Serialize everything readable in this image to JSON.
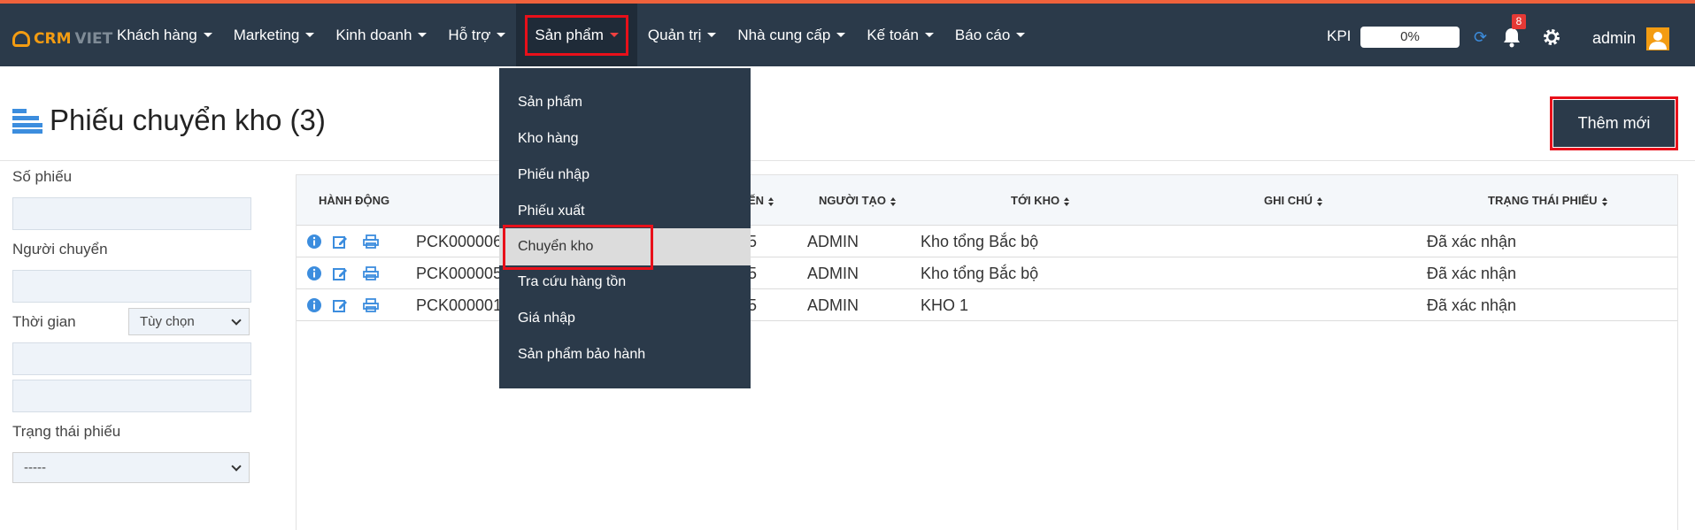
{
  "brand": {
    "logo_crm": "CRM",
    "logo_viet": "VIET"
  },
  "nav": [
    {
      "label": "Khách hàng"
    },
    {
      "label": "Marketing"
    },
    {
      "label": "Kinh doanh"
    },
    {
      "label": "Hỗ trợ"
    },
    {
      "label": "Sản phẩm",
      "active": true
    },
    {
      "label": "Quản trị"
    },
    {
      "label": "Nhà cung cấp"
    },
    {
      "label": "Kế toán"
    },
    {
      "label": "Báo cáo"
    }
  ],
  "header_right": {
    "kpi_label": "KPI",
    "kpi_value": "0%",
    "notification_count": "8",
    "user_name": "admin"
  },
  "page": {
    "title": "Phiếu chuyển kho (3)",
    "add_button_label": "Thêm mới"
  },
  "filters": {
    "so_phieu_label": "Số phiếu",
    "nguoi_chuyen_label": "Người chuyển",
    "thoi_gian_label": "Thời gian",
    "thoi_gian_select": "Tùy chọn",
    "trang_thai_label": "Trạng thái phiếu",
    "trang_thai_select": "-----"
  },
  "table": {
    "headers": {
      "action": "Hành động",
      "partial": "ẾN",
      "creator": "Người tạo",
      "to_warehouse": "Tới kho",
      "note": "Ghi chú",
      "status": "Trạng thái phiếu"
    },
    "rows": [
      {
        "code": "PCK000006",
        "partial": "5",
        "creator": "ADMIN",
        "to_warehouse": "Kho tổng Bắc bộ",
        "note": "",
        "status": "Đã xác nhận"
      },
      {
        "code": "PCK000005",
        "partial": "5",
        "creator": "ADMIN",
        "to_warehouse": "Kho tổng Bắc bộ",
        "note": "",
        "status": "Đã xác nhận"
      },
      {
        "code": "PCK000001",
        "partial": "5",
        "creator": "ADMIN",
        "to_warehouse": "KHO 1",
        "note": "",
        "status": "Đã xác nhận"
      }
    ]
  },
  "dropdown": {
    "items": [
      {
        "label": "Sản phẩm"
      },
      {
        "label": "Kho hàng"
      },
      {
        "label": "Phiếu nhập"
      },
      {
        "label": "Phiếu xuất"
      },
      {
        "label": "Chuyển kho",
        "highlighted": true
      },
      {
        "label": "Tra cứu hàng tồn"
      },
      {
        "label": "Giá nhập"
      },
      {
        "label": "Sản phẩm bảo hành"
      }
    ]
  },
  "colors": {
    "topbar": "#2b3a4a",
    "accent_orange": "#f39c12",
    "highlight_red": "#e8101a",
    "icon_blue": "#3c8dde"
  }
}
